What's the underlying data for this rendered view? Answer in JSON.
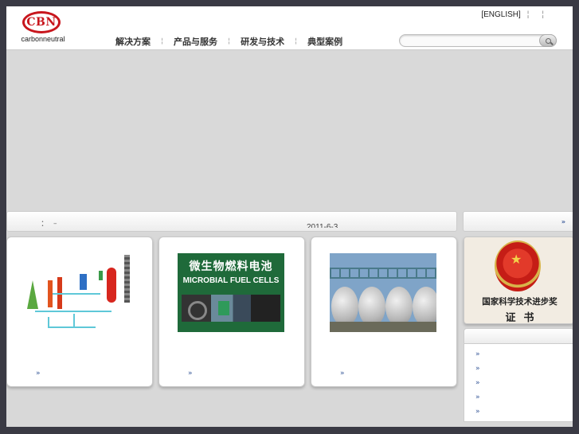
{
  "header": {
    "logo_text": "CBN",
    "logo_subtext": "carbonneutral",
    "top_links": [
      "[ENGLISH]",
      "",
      ""
    ],
    "nav": [
      "解决方案",
      "产品与服务",
      "研发与技术",
      "典型案例"
    ],
    "search": {
      "placeholder": ""
    }
  },
  "newsbar": {
    "colon": "：",
    "dash": "–",
    "date": "2011-6-3"
  },
  "side": {
    "header_arrow": "»",
    "certificate": {
      "line1": "国家科学技术进步奖",
      "line2": "证书"
    },
    "list_markers": [
      "»",
      "»",
      "»",
      "»",
      "»"
    ]
  },
  "cards": [
    {
      "image": "process-flow-diagram",
      "more": "»"
    },
    {
      "image": "microbial-fuel-cells",
      "title_cn": "微生物燃料电池",
      "title_en": "MICROBIAL FUEL CELLS",
      "more": "»"
    },
    {
      "image": "storage-tanks",
      "more": "»"
    }
  ],
  "colors": {
    "brand_red": "#c8161d",
    "link_blue": "#3a5a9a"
  }
}
